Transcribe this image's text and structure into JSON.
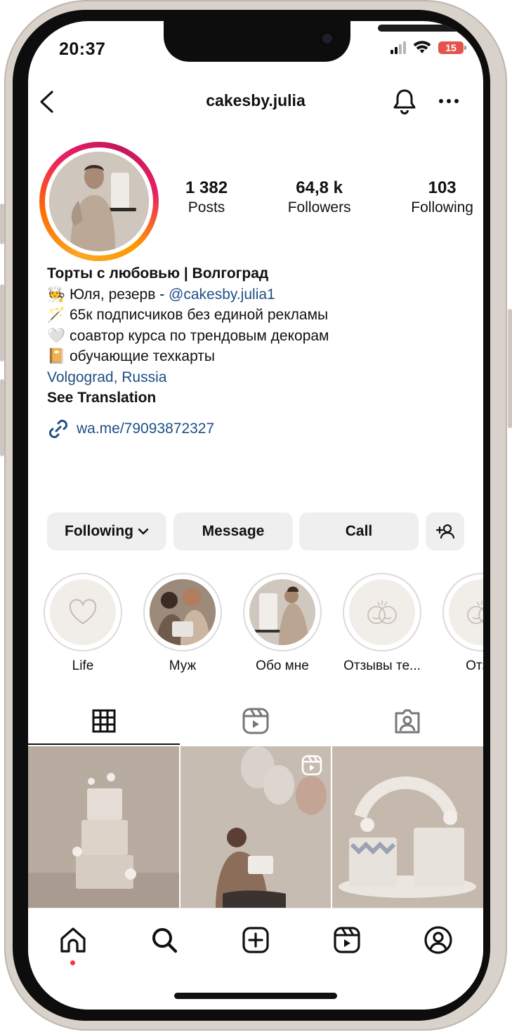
{
  "status_bar": {
    "time": "20:37",
    "battery": "15"
  },
  "header": {
    "username": "cakesby.julia",
    "back_icon": "chevron-left-icon",
    "notification_icon": "bell-icon",
    "more_icon": "more-horizontal-icon"
  },
  "profile": {
    "stats": [
      {
        "value": "1 382",
        "label": "Posts"
      },
      {
        "value": "64,8 k",
        "label": "Followers"
      },
      {
        "value": "103",
        "label": "Following"
      }
    ],
    "bio": {
      "name": "Торты с любовью | Волгоград",
      "line1_prefix": "Юля, резерв - ",
      "line1_mention": "@cakesby.julia1",
      "line2": "65к подписчиков без единой рекламы",
      "line3": "соавтор курса по трендовым декорам",
      "line4": "обучающие техкарты",
      "location": "Volgograd, Russia",
      "translation": "See Translation"
    },
    "link": "wa.me/79093872327"
  },
  "actions": {
    "following": "Following",
    "message": "Message",
    "call": "Call"
  },
  "highlights": [
    "Life",
    "Муж",
    "Обо мне",
    "Отзывы те...",
    "Отзы"
  ],
  "tabs": [
    "grid-icon",
    "reels-icon",
    "tagged-icon"
  ],
  "bottom_nav": [
    "home-icon",
    "search-icon",
    "create-icon",
    "reels-icon",
    "profile-icon"
  ],
  "colors": {
    "link": "#1e4e86",
    "button_bg": "#efefef",
    "notify_dot": "#ff3040"
  }
}
